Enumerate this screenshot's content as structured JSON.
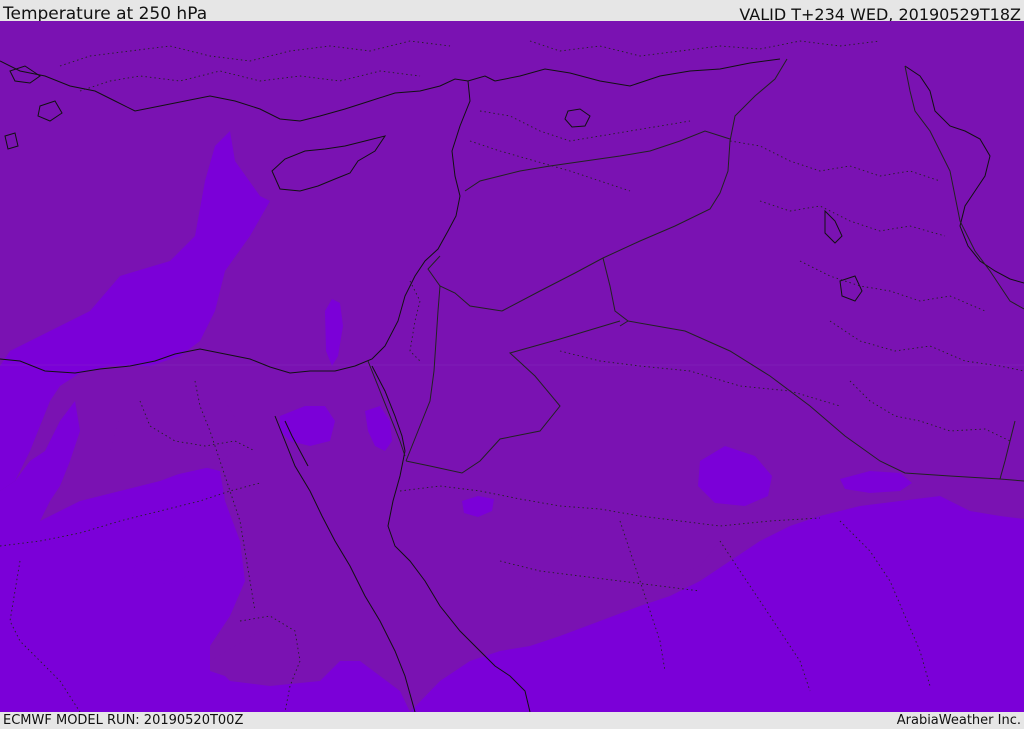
{
  "header": {
    "title": "Temperature at 250 hPa",
    "valid": "VALID T+234 WED, 20190529T18Z"
  },
  "footer": {
    "model_run": "ECMWF MODEL RUN: 20190520T00Z",
    "credit": "ArabiaWeather Inc."
  },
  "colors": {
    "field_warm": "#7a12b2",
    "field_cold": "#7b00d8",
    "coast_line": "#111111",
    "border_line": "#222222",
    "chrome": "#e6e6e6"
  }
}
